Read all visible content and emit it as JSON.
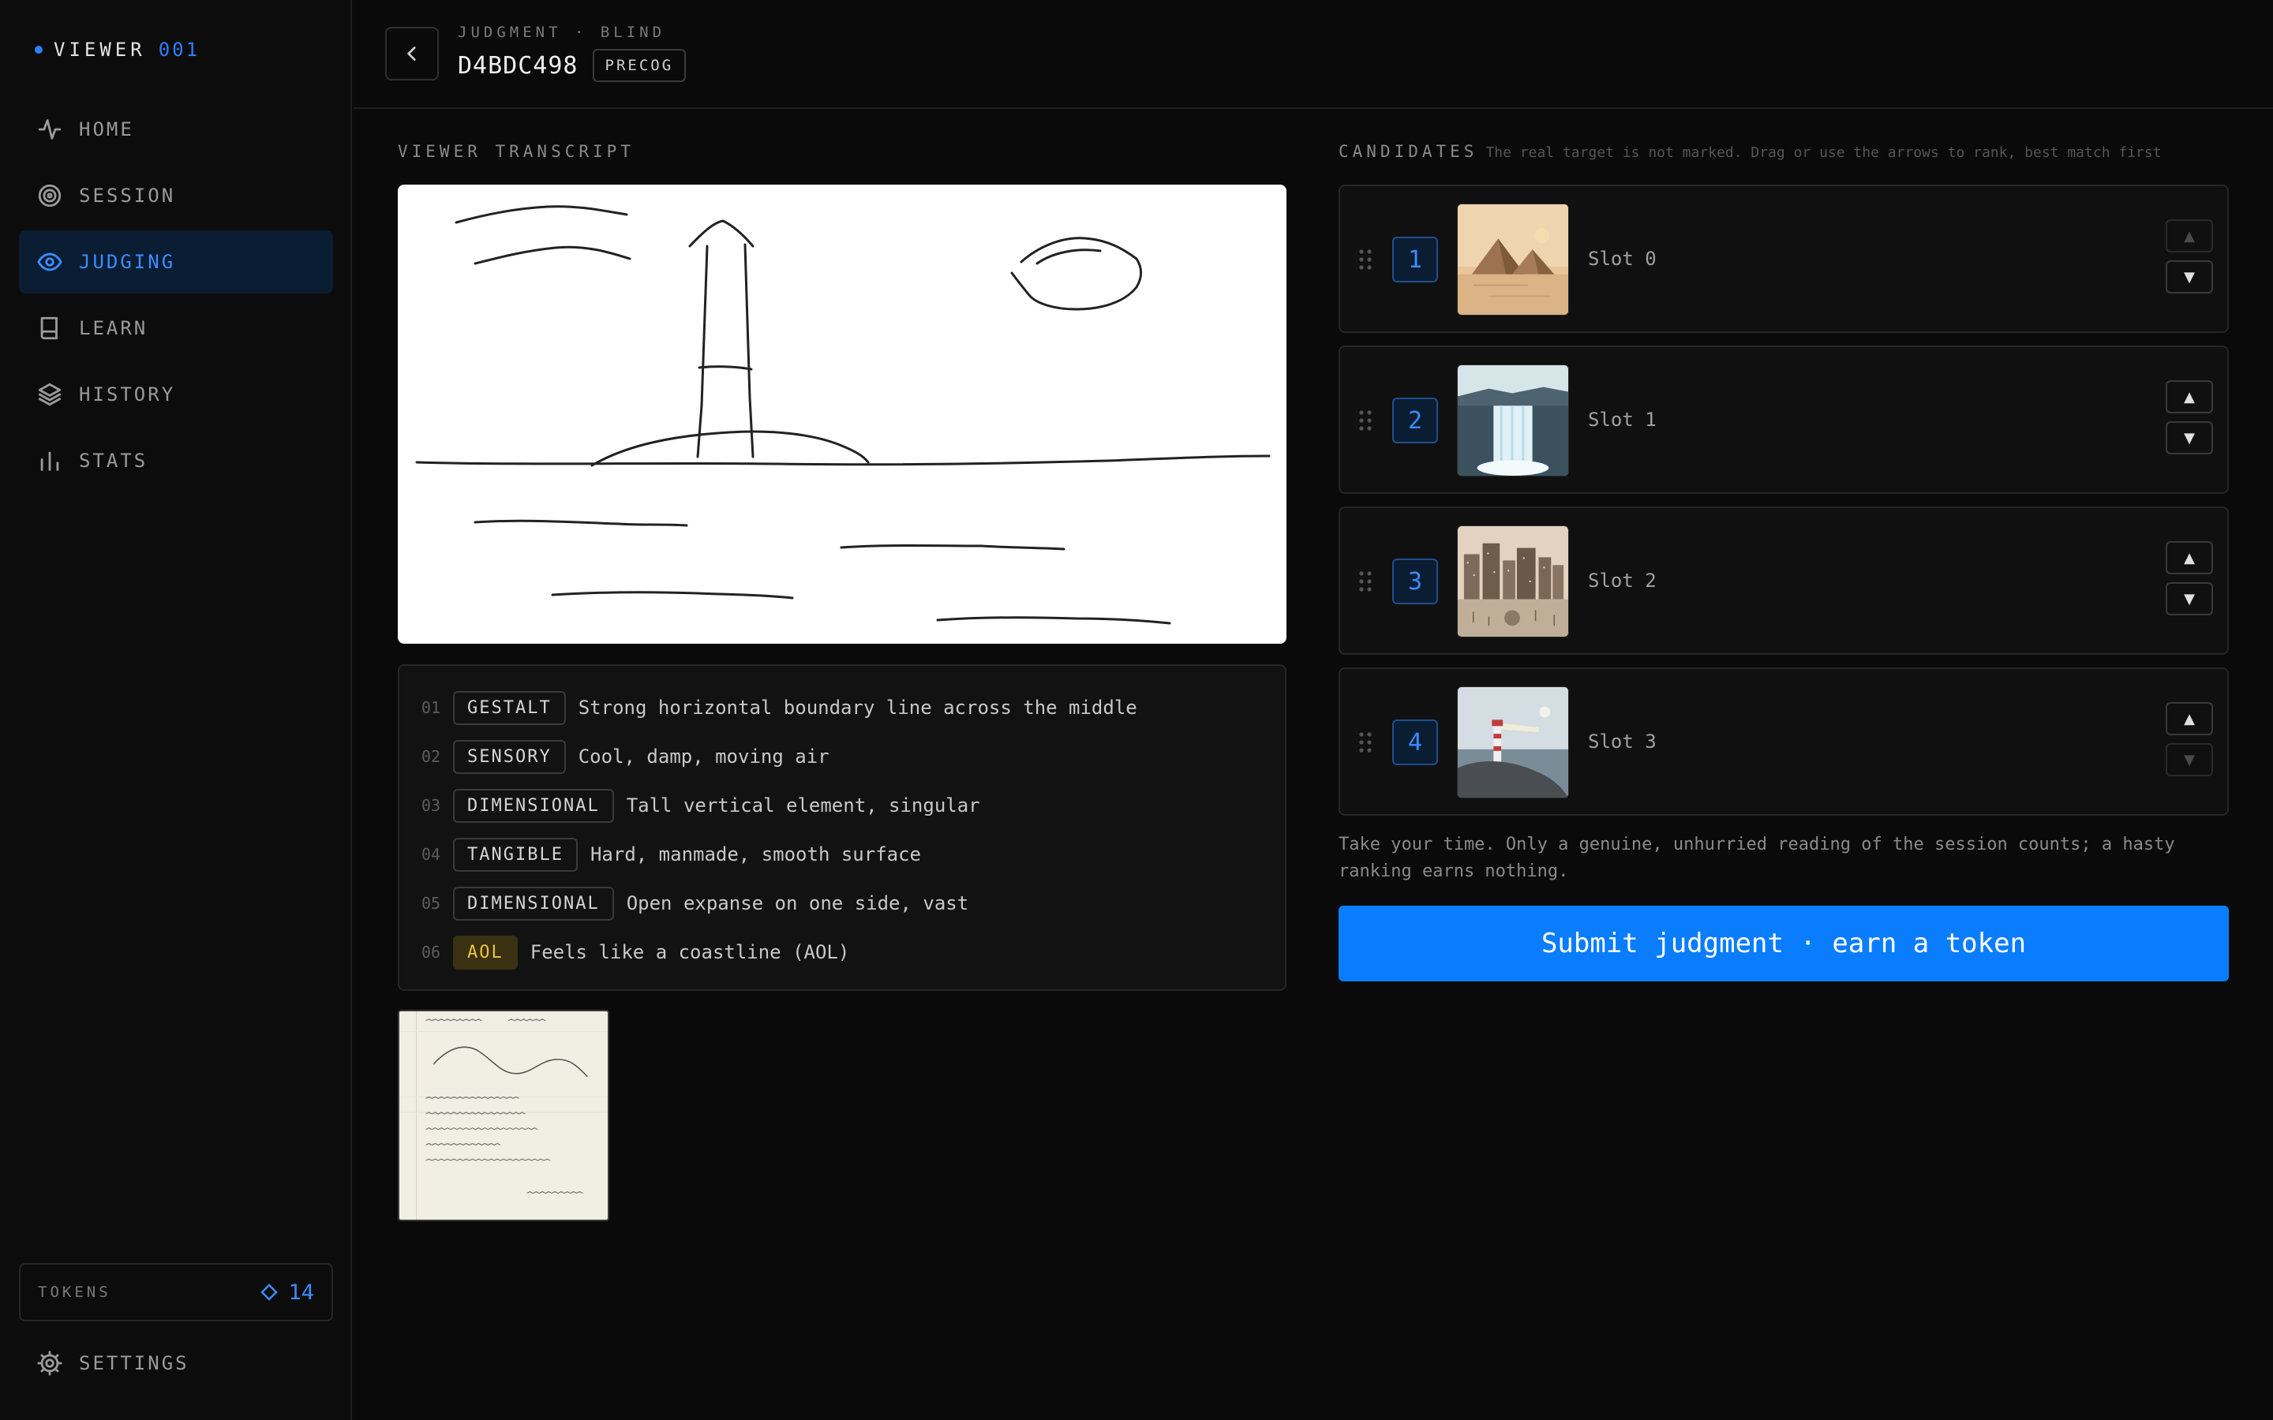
{
  "brand": {
    "name": "VIEWER",
    "number": "001"
  },
  "nav": [
    {
      "label": "HOME",
      "icon": "activity-icon",
      "active": false
    },
    {
      "label": "SESSION",
      "icon": "target-icon",
      "active": false
    },
    {
      "label": "JUDGING",
      "icon": "eye-icon",
      "active": true
    },
    {
      "label": "LEARN",
      "icon": "book-icon",
      "active": false
    },
    {
      "label": "HISTORY",
      "icon": "layers-icon",
      "active": false
    },
    {
      "label": "STATS",
      "icon": "bar-chart-icon",
      "active": false
    }
  ],
  "tokens": {
    "label": "TOKENS",
    "value": "14",
    "icon": "diamond-icon"
  },
  "settings": {
    "label": "SETTINGS",
    "icon": "gear-icon"
  },
  "header": {
    "kicker": "JUDGMENT · BLIND",
    "title": "D4BDC498",
    "badge": "PRECOG",
    "back_icon": "chevron-left-icon"
  },
  "transcript": {
    "label": "VIEWER TRANSCRIPT",
    "notes": [
      {
        "num": "01",
        "tag": "GESTALT",
        "text": "Strong horizontal boundary line across the middle"
      },
      {
        "num": "02",
        "tag": "SENSORY",
        "text": "Cool, damp, moving air"
      },
      {
        "num": "03",
        "tag": "DIMENSIONAL",
        "text": "Tall vertical element, singular"
      },
      {
        "num": "04",
        "tag": "TANGIBLE",
        "text": "Hard, manmade, smooth surface"
      },
      {
        "num": "05",
        "tag": "DIMENSIONAL",
        "text": "Open expanse on one side, vast"
      },
      {
        "num": "06",
        "tag": "AOL",
        "text": "Feels like a coastline (AOL)"
      }
    ]
  },
  "candidates": {
    "title": "CANDIDATES",
    "hint": "The real target is not marked. Drag or use the arrows to rank, best match first",
    "items": [
      {
        "rank": "1",
        "slot": "Slot 0",
        "image": "desert-pyramids",
        "up_disabled": true,
        "down_disabled": false
      },
      {
        "rank": "2",
        "slot": "Slot 1",
        "image": "waterfall",
        "up_disabled": false,
        "down_disabled": false
      },
      {
        "rank": "3",
        "slot": "Slot 2",
        "image": "city-skyline",
        "up_disabled": false,
        "down_disabled": false
      },
      {
        "rank": "4",
        "slot": "Slot 3",
        "image": "lighthouse-coast",
        "up_disabled": false,
        "down_disabled": true
      }
    ],
    "up_glyph": "▲",
    "down_glyph": "▼",
    "grip_icon": "drag-handle-icon"
  },
  "advice": "Take your time. Only a genuine, unhurried reading of the session counts; a hasty ranking earns nothing.",
  "submit_label": "Submit judgment · earn a token",
  "colors": {
    "accent": "#0a7dff",
    "accent_text": "#3b8cff",
    "aol": "#f0c33c",
    "background": "#0a0a0a"
  }
}
